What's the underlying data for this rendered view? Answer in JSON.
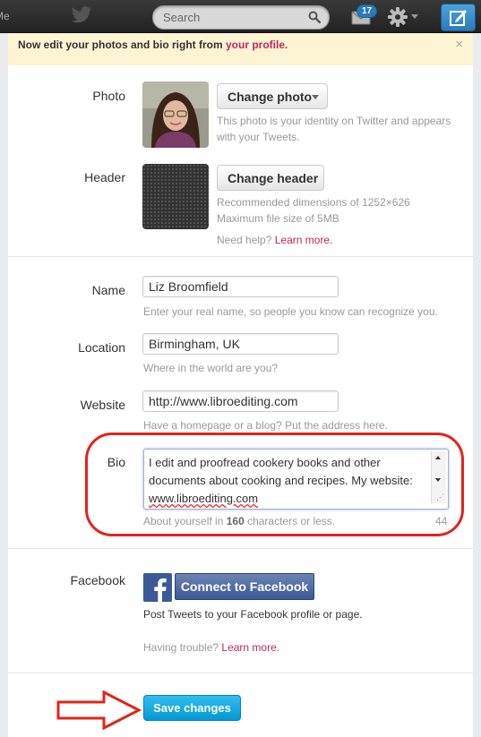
{
  "topbar": {
    "me_label": "Me",
    "search_placeholder": "Search",
    "dm_count": "17"
  },
  "notice": {
    "text": "Now edit your photos and bio right from ",
    "link": "your profile.",
    "close": "×"
  },
  "photo": {
    "label": "Photo",
    "button": "Change photo",
    "help": "This photo is your identity on Twitter and appears with your Tweets."
  },
  "header": {
    "label": "Header",
    "button": "Change header",
    "help_line1": "Recommended dimensions of 1252×626",
    "help_line2": "Maximum file size of 5MB",
    "help_prefix": "Need help? ",
    "help_link": "Learn more."
  },
  "name": {
    "label": "Name",
    "value": "Liz Broomfield",
    "help": "Enter your real name, so people you know can recognize you."
  },
  "location": {
    "label": "Location",
    "value": "Birmingham, UK",
    "help": "Where in the world are you?"
  },
  "website": {
    "label": "Website",
    "value": "http://www.libroediting.com",
    "help": "Have a homepage or a blog? Put the address here."
  },
  "bio": {
    "label": "Bio",
    "text": "I edit and proofread cookery books and other documents about cooking and recipes. My website: ",
    "url": "www.libroediting.com",
    "help_prefix": "About yourself in ",
    "help_count": "160",
    "help_suffix": " characters or less.",
    "remaining": "44"
  },
  "facebook": {
    "label": "Facebook",
    "button": "Connect to Facebook",
    "help": "Post Tweets to your Facebook profile or page.",
    "trouble_prefix": "Having trouble? ",
    "trouble_link": "Learn more."
  },
  "save_button": "Save changes",
  "colors": {
    "link": "#c0265e",
    "primary": "#019ad2",
    "facebook": "#3b5998",
    "annotation": "#e2231a"
  }
}
